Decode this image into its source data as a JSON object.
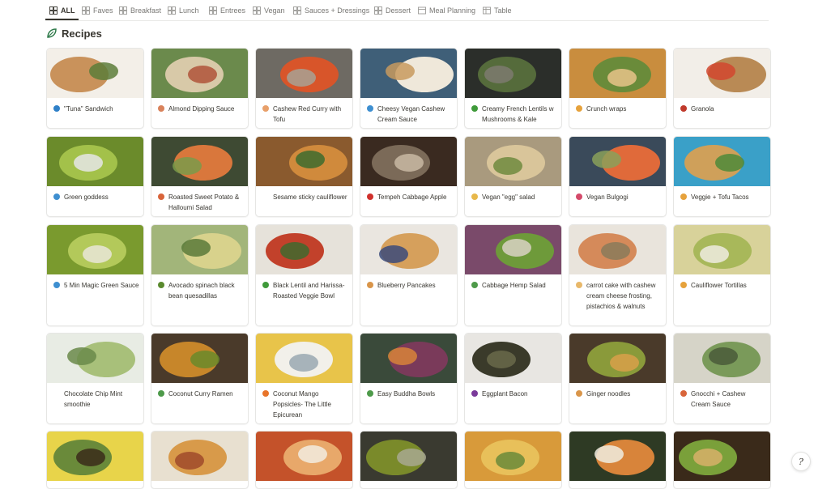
{
  "tabs": [
    {
      "label": "ALL",
      "icon": "grid-icon"
    },
    {
      "label": "Faves",
      "icon": "grid-icon"
    },
    {
      "label": "Breakfast",
      "icon": "grid-icon"
    },
    {
      "label": "Lunch",
      "icon": "grid-icon"
    },
    {
      "label": "Entrees",
      "icon": "grid-icon"
    },
    {
      "label": "Vegan",
      "icon": "grid-icon"
    },
    {
      "label": "Sauces + Dressings",
      "icon": "grid-icon"
    },
    {
      "label": "Dessert",
      "icon": "grid-icon"
    },
    {
      "label": "Meal Planning",
      "icon": "calendar-icon"
    },
    {
      "label": "Table",
      "icon": "table-icon"
    }
  ],
  "page": {
    "title": "Recipes",
    "icon": "leaf-icon"
  },
  "recipes": [
    {
      "label": "\"Tuna\" Sandwich",
      "icon": "fish-icon",
      "icon_color": "#2f80c8",
      "colors": [
        "#f3efe8",
        "#c9925b",
        "#5c7d3a"
      ]
    },
    {
      "label": "Almond Dipping Sauce",
      "icon": "almond-icon",
      "icon_color": "#d9825b",
      "colors": [
        "#6b8a4c",
        "#d8c9a8",
        "#b0533a"
      ]
    },
    {
      "label": "Cashew Red Curry with Tofu",
      "icon": "curry-icon",
      "icon_color": "#e8a06a",
      "colors": [
        "#6e6a63",
        "#d8552a",
        "#a8a294"
      ]
    },
    {
      "label": "Cheesy Vegan Cashew Cream Sauce",
      "icon": "droplet-icon",
      "icon_color": "#3e8fd0",
      "colors": [
        "#3f5f78",
        "#efe8da",
        "#c89a5e"
      ]
    },
    {
      "label": "Creamy  French Lentils w Mushrooms & Kale",
      "icon": "leafy-greens-icon",
      "icon_color": "#3f9a3a",
      "colors": [
        "#2b2e2a",
        "#556b3b",
        "#7e7a70"
      ]
    },
    {
      "label": "Crunch wraps",
      "icon": "taco-icon",
      "icon_color": "#e6a23c",
      "colors": [
        "#c98d3e",
        "#6a8b3a",
        "#e8c38a"
      ]
    },
    {
      "label": "Granola",
      "icon": "bowl-icon",
      "icon_color": "#c0392b",
      "colors": [
        "#f2eee8",
        "#b98a55",
        "#d1462f"
      ]
    },
    {
      "label": "Green goddess",
      "icon": "droplet-icon",
      "icon_color": "#3e8fd0",
      "colors": [
        "#6b8b2b",
        "#a3c14a",
        "#e6e6e6"
      ]
    },
    {
      "label": "Roasted Sweet Potato & Halloumi Salad",
      "icon": "sweet-potato-icon",
      "icon_color": "#d8643a",
      "colors": [
        "#3e4a33",
        "#d9773c",
        "#7a9a4a"
      ]
    },
    {
      "label": "Sesame sticky cauliflower",
      "icon": "",
      "icon_color": "",
      "colors": [
        "#8a5a2e",
        "#d08a3c",
        "#3d6b2e"
      ]
    },
    {
      "label": "Tempeh Cabbage Apple",
      "icon": "apple-icon",
      "icon_color": "#d0312d",
      "colors": [
        "#3a2a20",
        "#7b6a58",
        "#c9b9a3"
      ]
    },
    {
      "label": "Vegan \"egg\" salad",
      "icon": "sandwich-icon",
      "icon_color": "#e8b84a",
      "colors": [
        "#a99a7e",
        "#d9c59a",
        "#6e8a3e"
      ]
    },
    {
      "label": "Vegan Bulgogi",
      "icon": "bento-icon",
      "icon_color": "#d44a6a",
      "colors": [
        "#3a4a5a",
        "#e06a3a",
        "#8aa05a"
      ]
    },
    {
      "label": "Veggie + Tofu Tacos",
      "icon": "taco-icon",
      "icon_color": "#e6a23c",
      "colors": [
        "#3aa0c8",
        "#cfa05a",
        "#4e8a3a"
      ]
    },
    {
      "label": "5 Min Magic Green Sauce",
      "icon": "droplet-icon",
      "icon_color": "#3e8fd0",
      "colors": [
        "#7a9a2e",
        "#b3c95a",
        "#e9e6d8"
      ]
    },
    {
      "label": "Avocado spinach black bean quesadillas",
      "icon": "avocado-icon",
      "icon_color": "#5a8a2e",
      "colors": [
        "#a2b57a",
        "#d8d28c",
        "#5a7a3a"
      ]
    },
    {
      "label": "Black Lentil and Harissa-Roasted Veggie Bowl",
      "icon": "leafy-greens-icon",
      "icon_color": "#3f9a3a",
      "colors": [
        "#e6e2da",
        "#c2412b",
        "#3f6a2e"
      ]
    },
    {
      "label": "Blueberry Pancakes",
      "icon": "pancakes-icon",
      "icon_color": "#d9954a",
      "colors": [
        "#eae6e0",
        "#d6a05c",
        "#3b4a7a"
      ]
    },
    {
      "label": "Cabbage Hemp Salad",
      "icon": "salad-icon",
      "icon_color": "#4e9a4a",
      "colors": [
        "#7a4a6a",
        "#6e9a3a",
        "#d9d2c4"
      ]
    },
    {
      "label": "carrot cake with cashew cream cheese frosting, pistachios & walnuts",
      "icon": "cake-icon",
      "icon_color": "#e8b86a",
      "colors": [
        "#e9e4dc",
        "#d58a5a",
        "#8a7a5a"
      ]
    },
    {
      "label": "Cauliflower Tortillas",
      "icon": "taco-icon",
      "icon_color": "#e6a23c",
      "colors": [
        "#d8d29a",
        "#a8b85a",
        "#eeebe0"
      ]
    },
    {
      "label": "Chocolate Chip Mint smoothie",
      "icon": "",
      "icon_color": "",
      "colors": [
        "#e8ece4",
        "#a8c07a",
        "#6a8a4a"
      ]
    },
    {
      "label": "Coconut Curry Ramen",
      "icon": "ramen-icon",
      "icon_color": "#4e9a4a",
      "colors": [
        "#4a3a2a",
        "#c7862a",
        "#6a8a2a"
      ]
    },
    {
      "label": "Coconut Mango Popsicles- The Little Epicurean",
      "icon": "mango-icon",
      "icon_color": "#e8742a",
      "colors": [
        "#e8c44a",
        "#f2f0ea",
        "#9aa8b2"
      ]
    },
    {
      "label": "Easy Buddha Bowls",
      "icon": "salad-icon",
      "icon_color": "#4e9a4a",
      "colors": [
        "#3a4a3a",
        "#7a3a5a",
        "#d8843a"
      ]
    },
    {
      "label": "Eggplant Bacon",
      "icon": "eggplant-icon",
      "icon_color": "#7a3a9a",
      "colors": [
        "#e8e6e2",
        "#3a3a2a",
        "#6a6a4a"
      ]
    },
    {
      "label": "Ginger noodles",
      "icon": "noodles-icon",
      "icon_color": "#d9954a",
      "colors": [
        "#4a3a2a",
        "#8a9a3a",
        "#d8a04a"
      ]
    },
    {
      "label": "Gnocchi + Cashew Cream Sauce",
      "icon": "pasta-icon",
      "icon_color": "#d8643a",
      "colors": [
        "#d6d4c8",
        "#7a9a5a",
        "#4a5a3a"
      ]
    },
    {
      "label": "",
      "icon": "",
      "icon_color": "",
      "colors": [
        "#e8d44a",
        "#6a8a3a",
        "#3a2a1a"
      ]
    },
    {
      "label": "",
      "icon": "",
      "icon_color": "",
      "colors": [
        "#e8e0d0",
        "#d89a4a",
        "#a04a2a"
      ]
    },
    {
      "label": "",
      "icon": "",
      "icon_color": "",
      "colors": [
        "#c4522a",
        "#e8a86a",
        "#f2ecdf"
      ]
    },
    {
      "label": "",
      "icon": "",
      "icon_color": "",
      "colors": [
        "#3a3a30",
        "#7a8a2a",
        "#a8a890"
      ]
    },
    {
      "label": "",
      "icon": "",
      "icon_color": "",
      "colors": [
        "#d89a3a",
        "#e8c05a",
        "#6a8a3a"
      ]
    },
    {
      "label": "",
      "icon": "",
      "icon_color": "",
      "colors": [
        "#2e3a24",
        "#d8843a",
        "#f0ece0"
      ]
    },
    {
      "label": "",
      "icon": "",
      "icon_color": "",
      "colors": [
        "#3a2a1a",
        "#7aa03a",
        "#d8b06a"
      ]
    }
  ],
  "help_label": "?"
}
